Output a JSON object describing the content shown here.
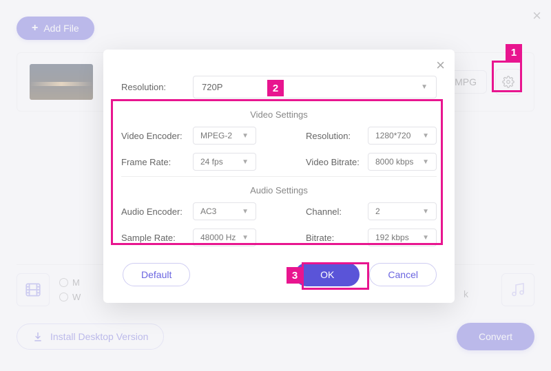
{
  "annotations": {
    "n1": "1",
    "n2": "2",
    "n3": "3"
  },
  "header": {
    "add_file_label": "Add File"
  },
  "file_card": {
    "format_label": "MPG"
  },
  "modal": {
    "resolution_label": "Resolution:",
    "resolution_value": "720P",
    "video_section_title": "Video Settings",
    "audio_section_title": "Audio Settings",
    "video": {
      "encoder_label": "Video Encoder:",
      "encoder_value": "MPEG-2",
      "framerate_label": "Frame Rate:",
      "framerate_value": "24 fps",
      "res_label": "Resolution:",
      "res_value": "1280*720",
      "bitrate_label": "Video Bitrate:",
      "bitrate_value": "8000 kbps"
    },
    "audio": {
      "encoder_label": "Audio Encoder:",
      "encoder_value": "AC3",
      "samplerate_label": "Sample Rate:",
      "samplerate_value": "48000 Hz",
      "channel_label": "Channel:",
      "channel_value": "2",
      "bitrate_label": "Bitrate:",
      "bitrate_value": "192 kbps"
    },
    "buttons": {
      "default": "Default",
      "ok": "OK",
      "cancel": "Cancel"
    }
  },
  "bottom": {
    "radio1": "M",
    "radio2": "W",
    "k": "k",
    "install_label": "Install Desktop Version",
    "convert_label": "Convert"
  }
}
